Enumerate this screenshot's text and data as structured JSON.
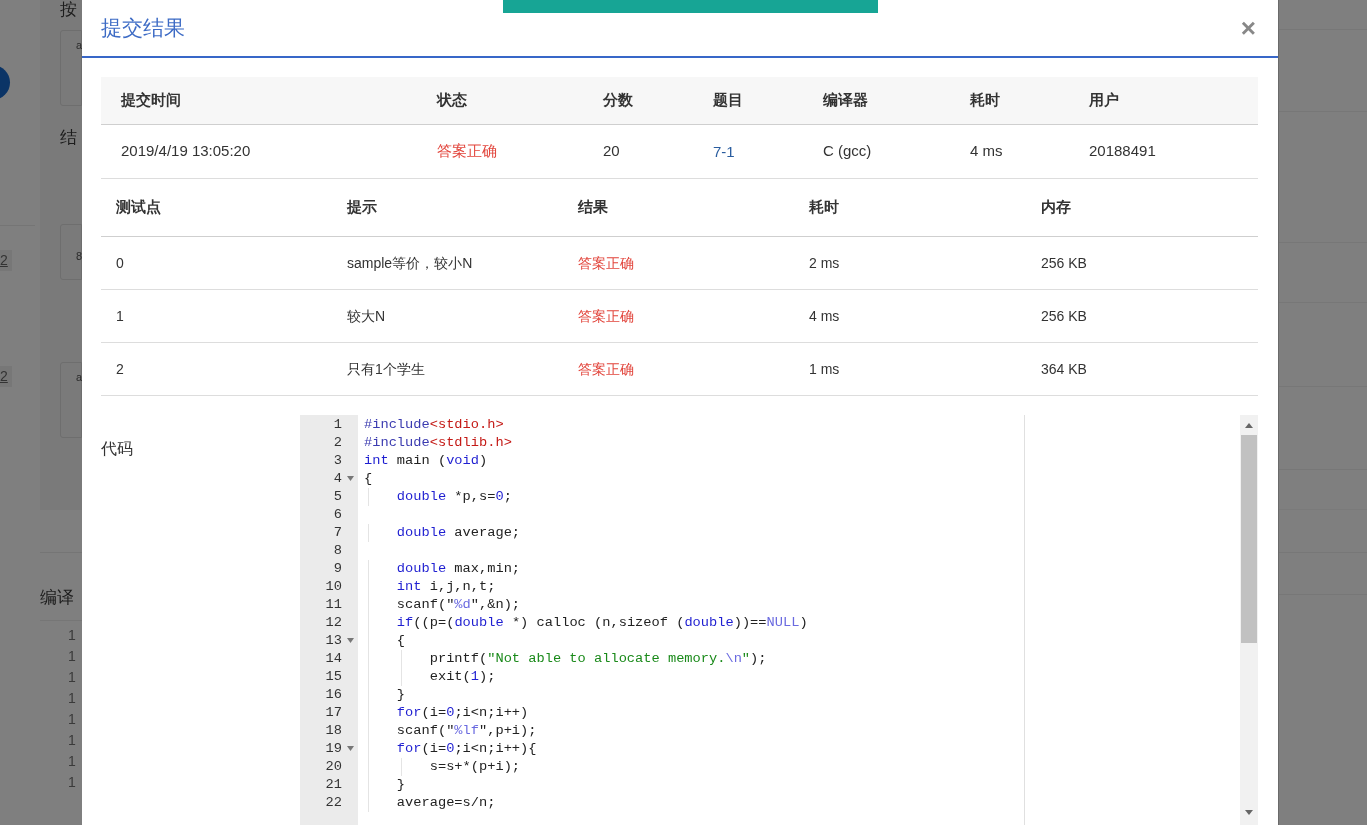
{
  "background_page": {
    "headings": [
      "按",
      "结"
    ],
    "sample_boxes": [
      {
        "lines": [
          "a"
        ]
      },
      {
        "lines": [
          "8"
        ]
      },
      {
        "lines": [
          "a"
        ]
      }
    ],
    "side_labels": [
      "2",
      "2"
    ],
    "section_title": "编译",
    "line_numbers": [
      "1",
      "1",
      "1",
      "1",
      "1",
      "1",
      "1",
      "1"
    ]
  },
  "notification": {
    "visible": true
  },
  "modal": {
    "title": "提交结果",
    "close": "×",
    "summary": {
      "columns": [
        "提交时间",
        "状态",
        "分数",
        "题目",
        "编译器",
        "耗时",
        "用户"
      ],
      "row": [
        {
          "kind": "text",
          "text": "2019/4/19 13:05:20"
        },
        {
          "kind": "status",
          "text": "答案正确"
        },
        {
          "kind": "text",
          "text": "20"
        },
        {
          "kind": "link",
          "text": "7-1"
        },
        {
          "kind": "text",
          "text": "C (gcc)"
        },
        {
          "kind": "text",
          "text": "4 ms"
        },
        {
          "kind": "text",
          "text": "20188491"
        }
      ]
    },
    "tests": {
      "columns": [
        "测试点",
        "提示",
        "结果",
        "耗时",
        "内存"
      ],
      "rows": [
        {
          "cells": [
            "0",
            "sample等价，较小N",
            "答案正确",
            "2 ms",
            "256 KB"
          ]
        },
        {
          "cells": [
            "1",
            "较大N",
            "答案正确",
            "4 ms",
            "256 KB"
          ]
        },
        {
          "cells": [
            "2",
            "只有1个学生",
            "答案正确",
            "1 ms",
            "364 KB"
          ]
        }
      ]
    },
    "code_label": "代码",
    "code_lines": [
      {
        "number": "1",
        "fold": false,
        "tokens": [
          {
            "kind": "pre",
            "text": "#include"
          },
          {
            "kind": "inc",
            "text": "<stdio.h>"
          }
        ]
      },
      {
        "number": "2",
        "fold": false,
        "tokens": [
          {
            "kind": "pre",
            "text": "#include"
          },
          {
            "kind": "inc",
            "text": "<stdlib.h>"
          }
        ]
      },
      {
        "number": "3",
        "fold": false,
        "tokens": [
          {
            "kind": "kw",
            "text": "int"
          },
          {
            "kind": "plain",
            "text": " main ("
          },
          {
            "kind": "kw",
            "text": "void"
          },
          {
            "kind": "plain",
            "text": ")"
          }
        ]
      },
      {
        "number": "4",
        "fold": true,
        "tokens": [
          {
            "kind": "plain",
            "text": "{"
          }
        ]
      },
      {
        "number": "5",
        "fold": false,
        "tokens": [
          {
            "kind": "kw",
            "text": "    double"
          },
          {
            "kind": "plain",
            "text": " *p,s="
          },
          {
            "kind": "num",
            "text": "0"
          },
          {
            "kind": "plain",
            "text": ";"
          }
        ]
      },
      {
        "number": "6",
        "fold": false
      },
      {
        "number": "7",
        "fold": false,
        "tokens": [
          {
            "kind": "kw",
            "text": "    double"
          },
          {
            "kind": "plain",
            "text": " average;"
          }
        ]
      },
      {
        "number": "8",
        "fold": false
      },
      {
        "number": "9",
        "fold": false,
        "tokens": [
          {
            "kind": "kw",
            "text": "    double"
          },
          {
            "kind": "plain",
            "text": " max,min;"
          }
        ]
      },
      {
        "number": "10",
        "fold": false,
        "tokens": [
          {
            "kind": "kw",
            "text": "    int"
          },
          {
            "kind": "plain",
            "text": " i,j,n,t;"
          }
        ]
      },
      {
        "number": "11",
        "fold": false,
        "tokens": [
          {
            "kind": "plain",
            "text": "    scanf(\""
          },
          {
            "kind": "fmt",
            "text": "%d"
          },
          {
            "kind": "plain",
            "text": "\",&n);"
          }
        ]
      },
      {
        "number": "12",
        "fold": false,
        "tokens": [
          {
            "kind": "kw",
            "text": "    if"
          },
          {
            "kind": "plain",
            "text": "((p=("
          },
          {
            "kind": "kw",
            "text": "double"
          },
          {
            "kind": "plain",
            "text": " *) calloc (n,sizeof ("
          },
          {
            "kind": "kw",
            "text": "double"
          },
          {
            "kind": "plain",
            "text": "))=="
          },
          {
            "kind": "fmt",
            "text": "NULL"
          },
          {
            "kind": "plain",
            "text": ")"
          }
        ]
      },
      {
        "number": "13",
        "fold": true,
        "tokens": [
          {
            "kind": "plain",
            "text": "    {"
          }
        ]
      },
      {
        "number": "14",
        "fold": false,
        "tokens": [
          {
            "kind": "plain",
            "text": "        printf("
          },
          {
            "kind": "str",
            "text": "\"Not able to allocate memory."
          },
          {
            "kind": "fmt",
            "text": "\\n"
          },
          {
            "kind": "str",
            "text": "\""
          },
          {
            "kind": "plain",
            "text": ");"
          }
        ]
      },
      {
        "number": "15",
        "fold": false,
        "tokens": [
          {
            "kind": "plain",
            "text": "        exit("
          },
          {
            "kind": "num",
            "text": "1"
          },
          {
            "kind": "plain",
            "text": ");"
          }
        ]
      },
      {
        "number": "16",
        "fold": false,
        "tokens": [
          {
            "kind": "plain",
            "text": "    }"
          }
        ]
      },
      {
        "number": "17",
        "fold": false,
        "tokens": [
          {
            "kind": "kw",
            "text": "    for"
          },
          {
            "kind": "plain",
            "text": "(i="
          },
          {
            "kind": "num",
            "text": "0"
          },
          {
            "kind": "plain",
            "text": ";i<n;i++)"
          }
        ]
      },
      {
        "number": "18",
        "fold": false,
        "tokens": [
          {
            "kind": "plain",
            "text": "    scanf(\""
          },
          {
            "kind": "fmt",
            "text": "%lf"
          },
          {
            "kind": "plain",
            "text": "\",p+i);"
          }
        ]
      },
      {
        "number": "19",
        "fold": true,
        "tokens": [
          {
            "kind": "kw",
            "text": "    for"
          },
          {
            "kind": "plain",
            "text": "(i="
          },
          {
            "kind": "num",
            "text": "0"
          },
          {
            "kind": "plain",
            "text": ";i<n;i++){"
          }
        ]
      },
      {
        "number": "20",
        "fold": false,
        "tokens": [
          {
            "kind": "plain",
            "text": "        s=s+*(p+i);"
          }
        ]
      },
      {
        "number": "21",
        "fold": false,
        "tokens": [
          {
            "kind": "plain",
            "text": "    }"
          }
        ]
      },
      {
        "number": "22",
        "fold": false,
        "tokens": [
          {
            "kind": "plain",
            "text": "    average=s/n;"
          }
        ]
      }
    ]
  }
}
